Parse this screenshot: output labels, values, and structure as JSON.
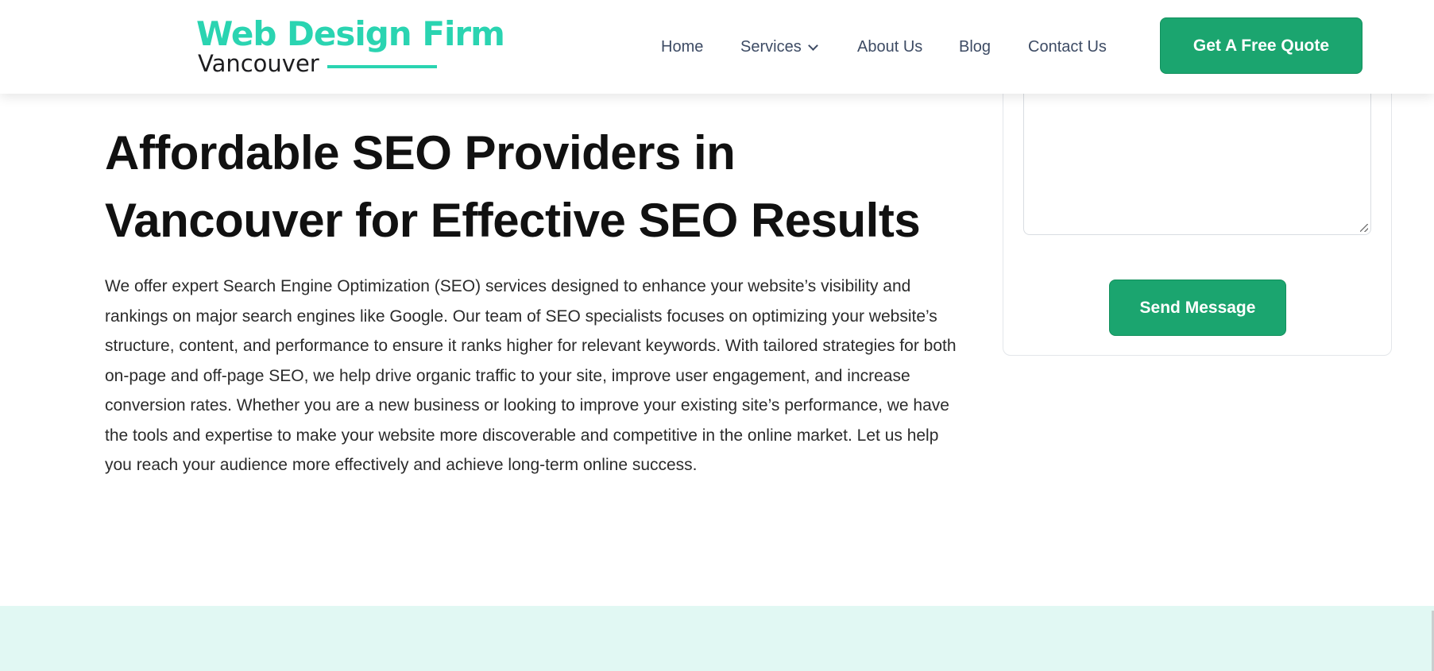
{
  "logo": {
    "line1": "Web Design Firm",
    "line2": "Vancouver",
    "brand_color": "#2ad4b1"
  },
  "nav": {
    "items": [
      {
        "label": "Home"
      },
      {
        "label": "Services"
      },
      {
        "label": "About Us"
      },
      {
        "label": "Blog"
      },
      {
        "label": "Contact Us"
      }
    ],
    "services_icon": "chevron-down-icon",
    "cta_label": "Get A Free Quote"
  },
  "main": {
    "title": "Affordable SEO Providers in Vancouver for Effective SEO Results",
    "body": "We offer expert Search Engine Optimization (SEO) services designed to enhance your website’s visibility and rankings on major search engines like Google. Our team of SEO specialists focuses on optimizing your website’s structure, content, and performance to ensure it ranks higher for relevant keywords. With tailored strategies for both on-page and off-page SEO, we help drive organic traffic to your site, improve user engagement, and increase conversion rates. Whether you are a new business or looking to improve your existing site’s performance, we have the tools and expertise to make your website more discoverable and competitive in the online market. Let us help you reach your audience more effectively and achieve long-term online success."
  },
  "form": {
    "message_value": "",
    "send_label": "Send Message"
  },
  "colors": {
    "accent": "#1ba56f",
    "nav_text": "#3d4b64",
    "band": "#e1f8f3"
  }
}
